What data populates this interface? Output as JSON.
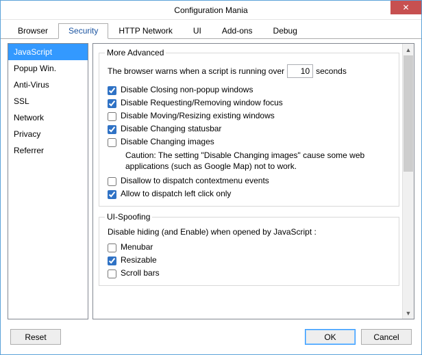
{
  "window": {
    "title": "Configuration Mania",
    "close_glyph": "✕"
  },
  "tabs": {
    "items": [
      {
        "label": "Browser"
      },
      {
        "label": "Security"
      },
      {
        "label": "HTTP Network"
      },
      {
        "label": "UI"
      },
      {
        "label": "Add-ons"
      },
      {
        "label": "Debug"
      }
    ],
    "active_index": 1
  },
  "sidebar": {
    "items": [
      {
        "label": "JavaScript"
      },
      {
        "label": "Popup Win."
      },
      {
        "label": "Anti-Virus"
      },
      {
        "label": "SSL"
      },
      {
        "label": "Network"
      },
      {
        "label": "Privacy"
      },
      {
        "label": "Referrer"
      }
    ],
    "selected_index": 0
  },
  "advanced": {
    "legend": "More Advanced",
    "warn_prefix": "The browser warns when a script is running over",
    "warn_value": "10",
    "warn_suffix": "seconds",
    "opts": [
      {
        "label": "Disable Closing non-popup windows",
        "checked": true
      },
      {
        "label": "Disable Requesting/Removing window focus",
        "checked": true
      },
      {
        "label": "Disable Moving/Resizing existing windows",
        "checked": false
      },
      {
        "label": "Disable Changing statusbar",
        "checked": true
      },
      {
        "label": "Disable Changing images",
        "checked": false
      }
    ],
    "caution": "Caution: The setting \"Disable Changing images\" cause some web applications (such as Google Map) not to work.",
    "opts2": [
      {
        "label": "Disallow to dispatch contextmenu events",
        "checked": false
      },
      {
        "label": "Allow to dispatch left click only",
        "checked": true
      }
    ]
  },
  "uispoof": {
    "legend": "UI-Spoofing",
    "note": "Disable hiding (and Enable) when opened by JavaScript :",
    "opts": [
      {
        "label": "Menubar",
        "checked": false
      },
      {
        "label": "Resizable",
        "checked": true
      },
      {
        "label": "Scroll bars",
        "checked": false
      }
    ]
  },
  "buttons": {
    "reset": "Reset",
    "ok": "OK",
    "cancel": "Cancel"
  },
  "scroll": {
    "up": "▲",
    "down": "▼"
  }
}
